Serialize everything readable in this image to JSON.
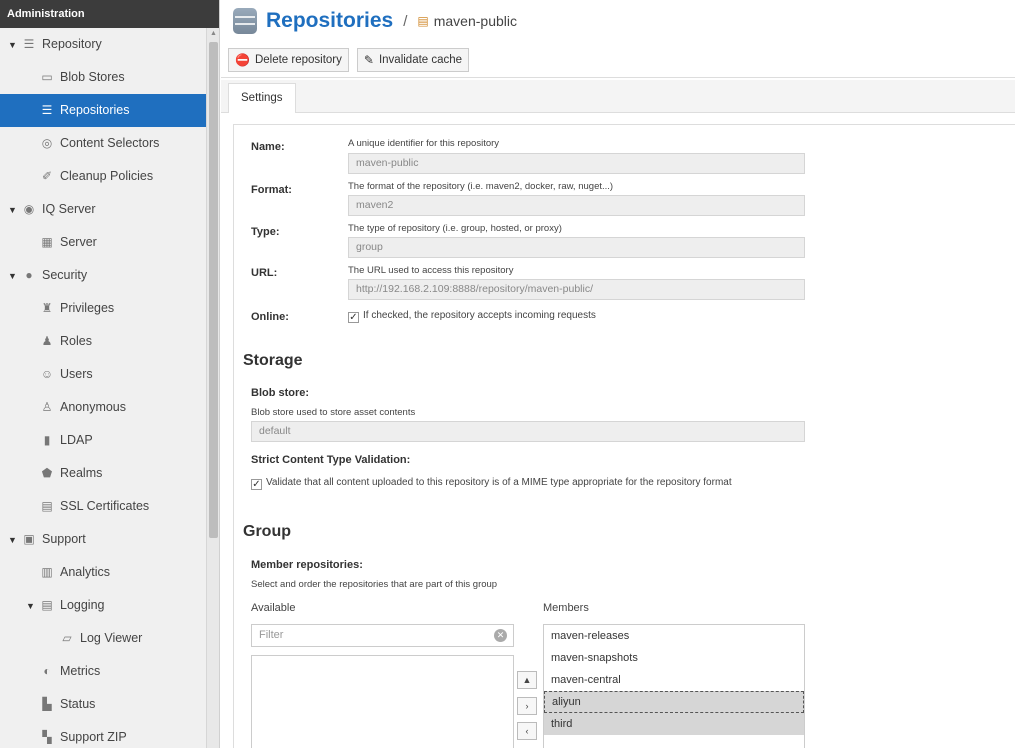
{
  "sidebar": {
    "header": "Administration",
    "items": [
      {
        "label": "Repository",
        "level": 0,
        "expanded": true,
        "icon": "database-icon"
      },
      {
        "label": "Blob Stores",
        "level": 1,
        "icon": "blob-store-icon"
      },
      {
        "label": "Repositories",
        "level": 1,
        "active": true,
        "icon": "database-icon"
      },
      {
        "label": "Content Selectors",
        "level": 1,
        "icon": "selector-icon"
      },
      {
        "label": "Cleanup Policies",
        "level": 1,
        "icon": "broom-icon"
      },
      {
        "label": "IQ Server",
        "level": 0,
        "expanded": true,
        "icon": "iq-server-icon"
      },
      {
        "label": "Server",
        "level": 1,
        "icon": "server-icon"
      },
      {
        "label": "Security",
        "level": 0,
        "expanded": true,
        "icon": "security-icon"
      },
      {
        "label": "Privileges",
        "level": 1,
        "icon": "medal-icon"
      },
      {
        "label": "Roles",
        "level": 1,
        "icon": "role-icon"
      },
      {
        "label": "Users",
        "level": 1,
        "icon": "users-icon"
      },
      {
        "label": "Anonymous",
        "level": 1,
        "icon": "anonymous-icon"
      },
      {
        "label": "LDAP",
        "level": 1,
        "icon": "ldap-book-icon"
      },
      {
        "label": "Realms",
        "level": 1,
        "icon": "shield-icon"
      },
      {
        "label": "SSL Certificates",
        "level": 1,
        "icon": "certificate-icon"
      },
      {
        "label": "Support",
        "level": 0,
        "expanded": true,
        "icon": "support-icon"
      },
      {
        "label": "Analytics",
        "level": 1,
        "icon": "analytics-icon"
      },
      {
        "label": "Logging",
        "level": 1,
        "expanded": true,
        "icon": "logging-icon"
      },
      {
        "label": "Log Viewer",
        "level": 2,
        "icon": "log-viewer-icon"
      },
      {
        "label": "Metrics",
        "level": 1,
        "icon": "metrics-icon"
      },
      {
        "label": "Status",
        "level": 1,
        "icon": "status-icon"
      },
      {
        "label": "Support ZIP",
        "level": 1,
        "icon": "zip-icon"
      }
    ]
  },
  "header": {
    "title": "Repositories",
    "separator": "/",
    "subtitle": "maven-public"
  },
  "toolbar": {
    "delete_label": "Delete repository",
    "invalidate_label": "Invalidate cache"
  },
  "tabs": {
    "settings": "Settings"
  },
  "form": {
    "name_label": "Name:",
    "name_help": "A unique identifier for this repository",
    "name_value": "maven-public",
    "format_label": "Format:",
    "format_help": "The format of the repository (i.e. maven2, docker, raw, nuget...)",
    "format_value": "maven2",
    "type_label": "Type:",
    "type_help": "The type of repository (i.e. group, hosted, or proxy)",
    "type_value": "group",
    "url_label": "URL:",
    "url_help": "The URL used to access this repository",
    "url_value": "http://192.168.2.109:8888/repository/maven-public/",
    "online_label": "Online:",
    "online_text": "If checked, the repository accepts incoming requests",
    "online_checked": true
  },
  "storage": {
    "title": "Storage",
    "blob_label": "Blob store:",
    "blob_help": "Blob store used to store asset contents",
    "blob_value": "default",
    "strict_label": "Strict Content Type Validation:",
    "strict_text": "Validate that all content uploaded to this repository is of a MIME type appropriate for the repository format",
    "strict_checked": true
  },
  "group": {
    "title": "Group",
    "members_label": "Member repositories:",
    "members_help": "Select and order the repositories that are part of this group",
    "available_header": "Available",
    "members_header": "Members",
    "filter_placeholder": "Filter",
    "members": [
      "maven-releases",
      "maven-snapshots",
      "maven-central",
      "aliyun",
      "third"
    ],
    "selected": [
      "aliyun",
      "third"
    ]
  },
  "colors": {
    "accent": "#1f6fbf",
    "sidebar_header": "#3c3c3c",
    "sidebar_bg": "#f0f0f0"
  }
}
